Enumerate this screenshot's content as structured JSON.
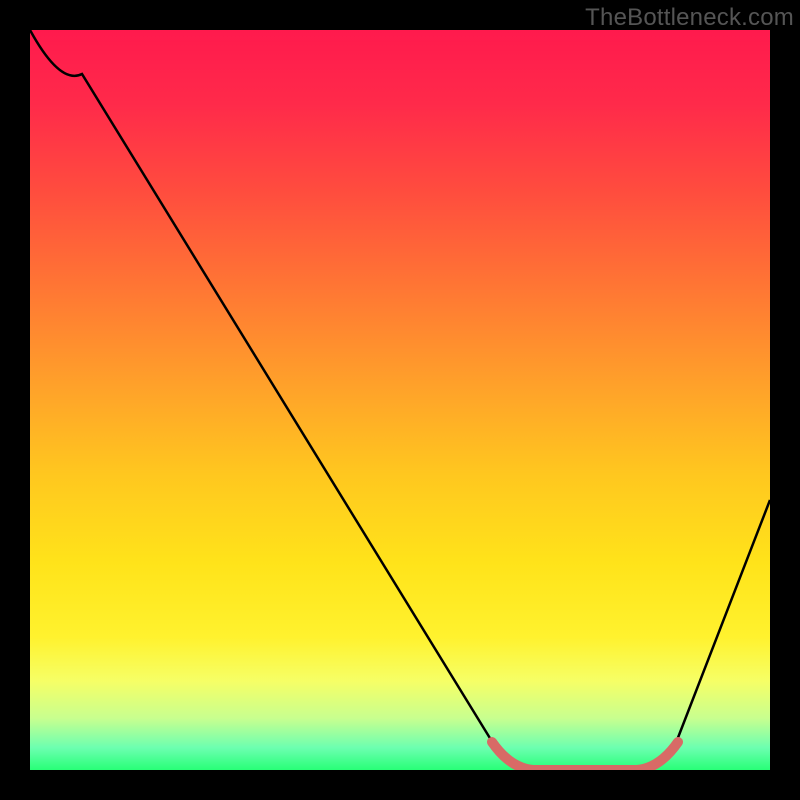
{
  "watermark": "TheBottleneck.com",
  "chart_data": {
    "type": "line",
    "title": "",
    "xlabel": "",
    "ylabel": "",
    "xlim": [
      0,
      100
    ],
    "ylim": [
      0,
      100
    ],
    "series": [
      {
        "name": "curve",
        "color": "#000000",
        "x": [
          0,
          7,
          63,
          68,
          82,
          87,
          100
        ],
        "y": [
          100,
          94,
          3,
          0,
          0,
          3,
          36
        ]
      },
      {
        "name": "highlight",
        "color": "#d86a66",
        "x": [
          63,
          68,
          82,
          87
        ],
        "y": [
          3,
          0,
          0,
          3
        ]
      }
    ],
    "notes": "Gradient background from red (top) through orange/yellow to green (bottom) representing a heat scale; black V-shaped curve reaching minimum near x≈68–82; short salmon/pink segment highlights the flat minimum region."
  }
}
